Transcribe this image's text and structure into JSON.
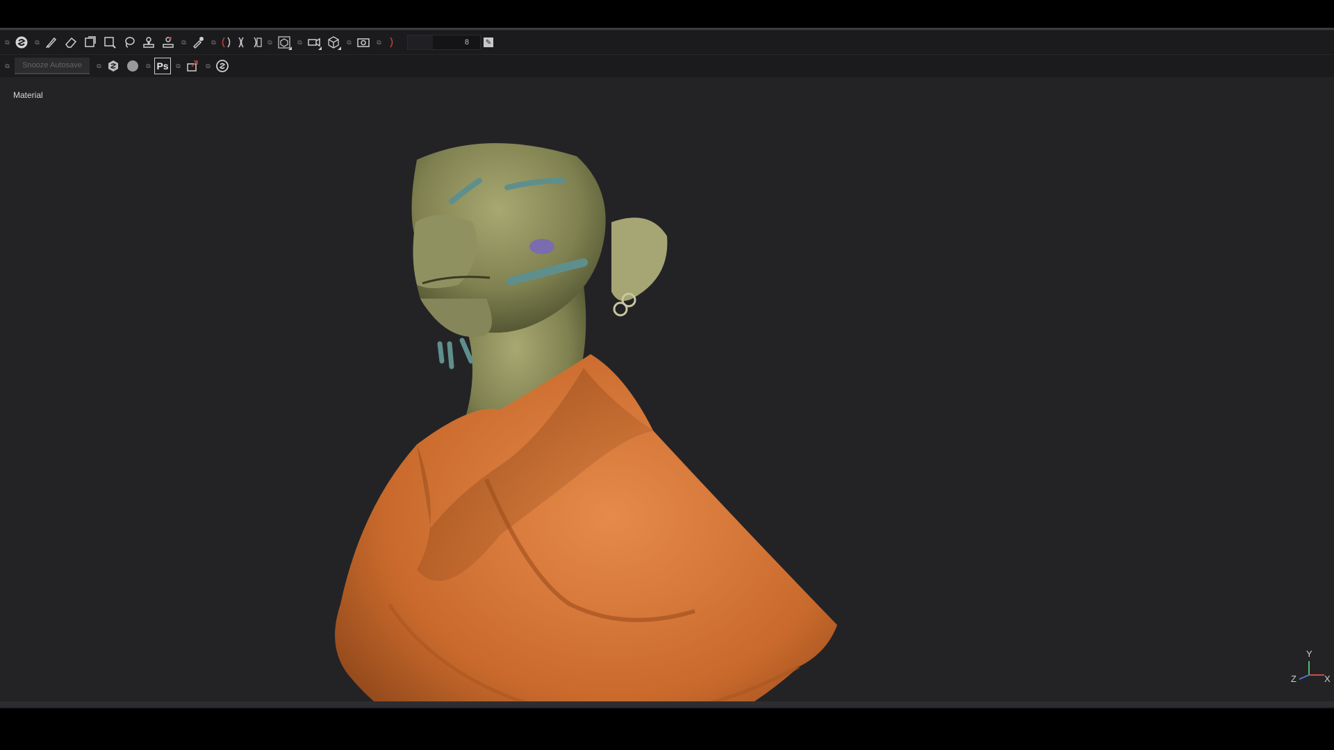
{
  "toolbar_primary": {
    "tools": [
      {
        "name": "substance-logo-icon"
      },
      {
        "name": "paint-brush-icon"
      },
      {
        "name": "eraser-icon"
      },
      {
        "name": "projection-icon"
      },
      {
        "name": "polygon-fill-icon"
      },
      {
        "name": "lasso-icon"
      },
      {
        "name": "clone-stamp-icon"
      },
      {
        "name": "smudge-icon"
      },
      {
        "name": "color-picker-icon"
      }
    ],
    "symmetry": [
      "mirror-left-icon",
      "mirror-both-icon",
      "mirror-right-icon"
    ],
    "brush_size": {
      "value": "8",
      "fraction": 0.35
    }
  },
  "toolbar_secondary": {
    "snooze_autosave_label": "Snooze Autosave",
    "ps_label": "Ps"
  },
  "viewport": {
    "mode_label": "Material",
    "axes": {
      "y": "Y",
      "z": "Z",
      "x": "X"
    }
  },
  "colors": {
    "panel_bg": "#232326",
    "toolbar_bg": "#1b1b1d",
    "axis_x": "#d64a4a",
    "axis_y": "#4ac26a",
    "axis_z": "#4a78d6"
  }
}
